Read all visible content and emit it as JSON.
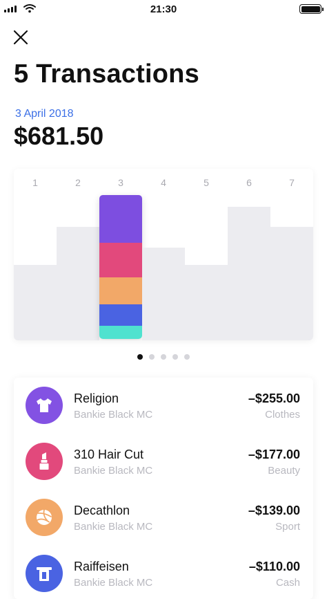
{
  "status_bar": {
    "time": "21:30"
  },
  "header": {
    "title": "5 Transactions",
    "date": "3 April 2018",
    "total": "$681.50"
  },
  "chart_data": {
    "type": "bar",
    "categories": [
      "1",
      "2",
      "3",
      "4",
      "5",
      "6",
      "7"
    ],
    "values": [
      0.44,
      0.66,
      0.95,
      0.54,
      0.44,
      0.78,
      0.66
    ],
    "selected_index": 2,
    "selected_breakdown": [
      {
        "label": "Religion",
        "share": 0.33,
        "color": "#7d4ee0"
      },
      {
        "label": "310 Hair Cut",
        "share": 0.24,
        "color": "#e2497c"
      },
      {
        "label": "Decathlon",
        "share": 0.19,
        "color": "#f2a868"
      },
      {
        "label": "Raiffeisen",
        "share": 0.15,
        "color": "#4a63e2"
      },
      {
        "label": "",
        "share": 0.09,
        "color": "#4fe2cf"
      }
    ],
    "bar_color": "#ececf0",
    "grid": false
  },
  "pager": {
    "count": 5,
    "active": 0
  },
  "transactions": [
    {
      "name": "Religion",
      "account": "Bankie Black MC",
      "amount": "–$255.00",
      "category": "Clothes",
      "icon": "tshirt-icon",
      "color": "#8352e3"
    },
    {
      "name": "310 Hair Cut",
      "account": "Bankie Black MC",
      "amount": "–$177.00",
      "category": "Beauty",
      "icon": "lipstick-icon",
      "color": "#e2497c"
    },
    {
      "name": "Decathlon",
      "account": "Bankie Black MC",
      "amount": "–$139.00",
      "category": "Sport",
      "icon": "volleyball-icon",
      "color": "#f2a868"
    },
    {
      "name": "Raiffeisen",
      "account": "Bankie Black MC",
      "amount": "–$110.00",
      "category": "Cash",
      "icon": "atm-card-icon",
      "color": "#4a63e2"
    }
  ]
}
